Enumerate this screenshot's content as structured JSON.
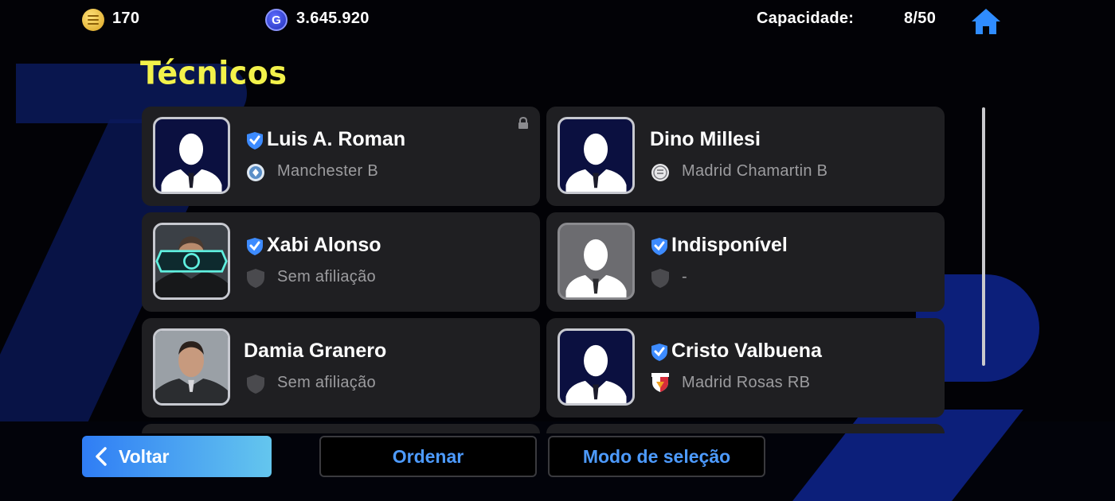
{
  "topbar": {
    "coins_e_value": "170",
    "coins_g_value": "3.645.920",
    "coin_g_letter": "G",
    "capacity_label": "Capacidade:",
    "capacity_value": "8/50"
  },
  "title": "Técnicos",
  "coaches": [
    {
      "name": "Luis A. Roman",
      "club": "Manchester B",
      "verified": true,
      "locked": true,
      "avatar": "silhouette-navy",
      "club_icon": "round-blue-crest"
    },
    {
      "name": "Dino Millesi",
      "club": "Madrid Chamartin B",
      "verified": false,
      "locked": false,
      "avatar": "silhouette-navy",
      "club_icon": "round-white-crest"
    },
    {
      "name": "Xabi Alonso",
      "club": "Sem afiliação",
      "verified": true,
      "locked": false,
      "avatar": "photo-epic",
      "club_icon": "grey-shield"
    },
    {
      "name": "Indisponível",
      "club": "-",
      "verified": true,
      "locked": false,
      "avatar": "silhouette-grey",
      "club_icon": "grey-shield"
    },
    {
      "name": "Damia Granero",
      "club": "Sem afiliação",
      "verified": false,
      "locked": false,
      "avatar": "photo",
      "club_icon": "grey-shield"
    },
    {
      "name": "Cristo Valbuena",
      "club": "Madrid Rosas RB",
      "verified": true,
      "locked": false,
      "avatar": "silhouette-navy",
      "club_icon": "red-white-crest"
    }
  ],
  "buttons": {
    "back": "Voltar",
    "sort": "Ordenar",
    "select_mode": "Modo de seleção"
  },
  "colors": {
    "title": "#f3f24a",
    "accent_blue": "#4d9bff",
    "card_bg": "#1f1f22",
    "back_gradient_start": "#2f7df5",
    "back_gradient_end": "#64c6ee",
    "verified_badge": "#3d8bff"
  }
}
